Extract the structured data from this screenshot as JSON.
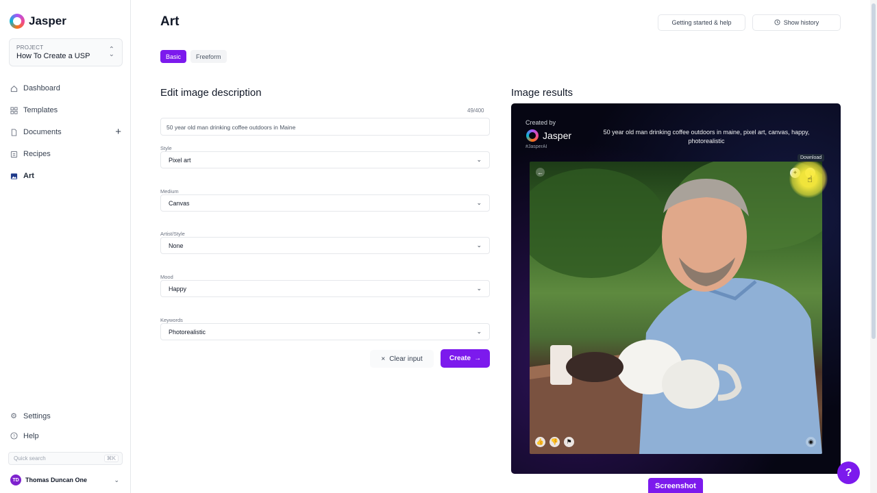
{
  "brand": {
    "name": "Jasper"
  },
  "project": {
    "label": "PROJECT",
    "name": "How To Create a USP"
  },
  "nav": {
    "items": [
      {
        "label": "Dashboard",
        "icon": "home-icon"
      },
      {
        "label": "Templates",
        "icon": "grid-icon"
      },
      {
        "label": "Documents",
        "icon": "document-icon"
      },
      {
        "label": "Recipes",
        "icon": "recipe-icon"
      },
      {
        "label": "Art",
        "icon": "image-icon"
      }
    ],
    "documents_add": "+",
    "bottom": [
      {
        "label": "Settings",
        "icon": "gear-icon"
      },
      {
        "label": "Help",
        "icon": "help-icon"
      }
    ],
    "quick_search_placeholder": "Quick search",
    "quick_search_shortcut": "⌘K"
  },
  "user": {
    "initials": "TD",
    "name": "Thomas Duncan One"
  },
  "header": {
    "title": "Art",
    "help_button": "Getting started & help",
    "history_button": "Show history"
  },
  "tabs": [
    {
      "label": "Basic",
      "active": true
    },
    {
      "label": "Freeform",
      "active": false
    }
  ],
  "editor": {
    "title": "Edit image description",
    "counter": "49/400",
    "description": "50 year old man drinking coffee outdoors in Maine",
    "fields": [
      {
        "label": "Style",
        "value": "Pixel art"
      },
      {
        "label": "Medium",
        "value": "Canvas"
      },
      {
        "label": "Artist/Style",
        "value": "None"
      },
      {
        "label": "Mood",
        "value": "Happy"
      },
      {
        "label": "Keywords",
        "value": "Photorealistic"
      }
    ],
    "clear_button": "Clear input",
    "create_button": "Create"
  },
  "results": {
    "title": "Image results",
    "created_by": "Created by",
    "brand": "Jasper",
    "hashtag": "#JasperAI",
    "caption": "50 year old man drinking coffee outdoors in maine, pixel art, canvas, happy, photorealistic",
    "tooltip": "Download"
  },
  "overlay": {
    "screenshot_button": "Screenshot",
    "help_fab": "?"
  },
  "colors": {
    "accent": "#7c1aed",
    "card_bg": "#060613"
  }
}
